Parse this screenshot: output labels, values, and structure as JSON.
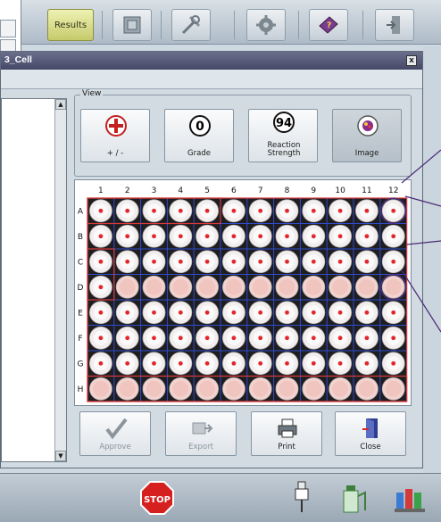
{
  "toolbar": {
    "results_label": "Results",
    "icons": [
      "results-tab",
      "report-icon",
      "tools-icon",
      "gear-icon",
      "help-book-icon",
      "exit-icon"
    ]
  },
  "window": {
    "title": "3_Cell",
    "close_label": "x"
  },
  "view": {
    "legend": "View",
    "buttons": [
      {
        "label": "+ / -",
        "icon": "plus-minus-icon"
      },
      {
        "label": "Grade",
        "icon_text": "0"
      },
      {
        "label": "Reaction Strength",
        "icon_text": "94"
      },
      {
        "label": "Image",
        "icon": "image-icon"
      }
    ]
  },
  "plate": {
    "columns": [
      "1",
      "2",
      "3",
      "4",
      "5",
      "6",
      "7",
      "8",
      "9",
      "10",
      "11",
      "12"
    ],
    "rows": [
      "A",
      "B",
      "C",
      "D",
      "E",
      "F",
      "G",
      "H"
    ]
  },
  "actions": {
    "approve": "Approve",
    "export": "Export",
    "print": "Print",
    "close": "Close"
  },
  "bottom": {
    "stop_label": "STOP"
  },
  "colors": {
    "title_bar": "#4f5272",
    "grid_blue": "#2f4cc9",
    "grid_red": "#d93a3a",
    "dot_red": "#e4262b",
    "callout": "#4b2a77"
  }
}
